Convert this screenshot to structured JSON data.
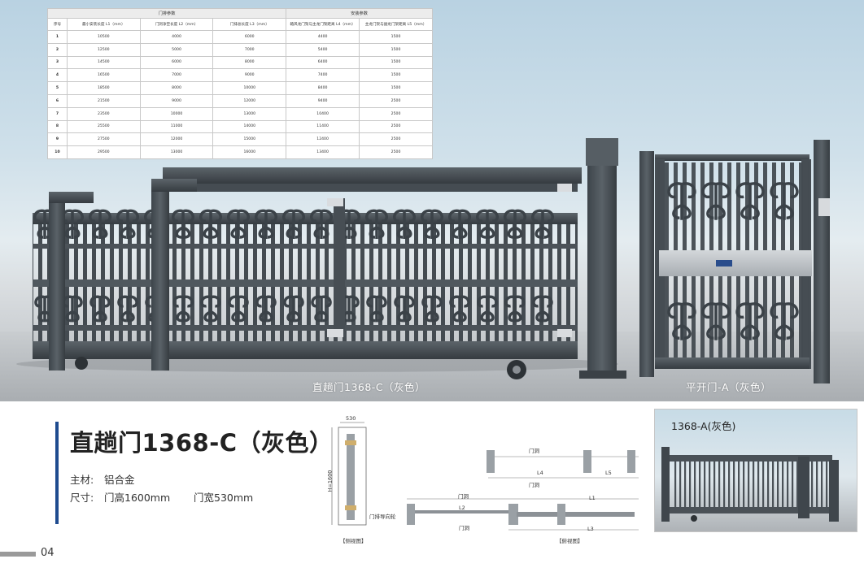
{
  "table": {
    "group_headers": [
      "门排参数",
      "安装参数"
    ],
    "columns": [
      "序号",
      "最小安装长度 L1（mm）",
      "门洞净空长度 L2（mm）",
      "门排总长度 L3（mm）",
      "箱风龙门架与主龙门架距离 L4（mm）",
      "主龙门架与副龙门架距离 L5（mm）"
    ],
    "rows": [
      [
        "1",
        "10500",
        "4000",
        "6000",
        "4400",
        "1500"
      ],
      [
        "2",
        "12500",
        "5000",
        "7000",
        "5400",
        "1500"
      ],
      [
        "3",
        "14500",
        "6000",
        "8000",
        "6400",
        "1500"
      ],
      [
        "4",
        "16500",
        "7000",
        "9000",
        "7400",
        "1500"
      ],
      [
        "5",
        "18500",
        "8000",
        "10000",
        "8400",
        "1500"
      ],
      [
        "6",
        "21500",
        "9000",
        "12000",
        "9400",
        "2500"
      ],
      [
        "7",
        "23500",
        "10000",
        "13000",
        "10400",
        "2500"
      ],
      [
        "8",
        "25500",
        "11000",
        "14000",
        "11400",
        "2500"
      ],
      [
        "9",
        "27500",
        "12000",
        "15000",
        "12400",
        "2500"
      ],
      [
        "10",
        "29500",
        "13000",
        "16000",
        "13400",
        "2500"
      ]
    ]
  },
  "hero": {
    "sliding_caption": "直趟门1368-C（灰色）",
    "swing_caption": "平开门-A（灰色）",
    "brand_plate": "豪美"
  },
  "product": {
    "title": "直趟门1368-C（灰色）",
    "material_label": "主材:",
    "material_value": "铝合金",
    "size_label": "尺寸:",
    "height_value": "门高1600mm",
    "width_value": "门宽530mm"
  },
  "side_view": {
    "width_dim": "530",
    "height_dim": "H=1600",
    "guide_note": "门排导向轮",
    "caption": "【侧视图】"
  },
  "top_view": {
    "door_post_top": "门洞",
    "door_post_bottom": "门洞",
    "l4": "L4",
    "l5": "L5",
    "l1": "L1",
    "l2": "L2",
    "l3": "L3",
    "door_label_a": "门洞",
    "door_label_b": "门洞",
    "caption": "【俯视图】"
  },
  "thumbnail": {
    "label": "1368-A(灰色)"
  },
  "page": {
    "number": "04"
  },
  "colors": {
    "accent_bar": "#1f4b8f",
    "gate_frame": "#4a5157",
    "gate_dark": "#3a4046",
    "plate": "#b7bcc1"
  }
}
